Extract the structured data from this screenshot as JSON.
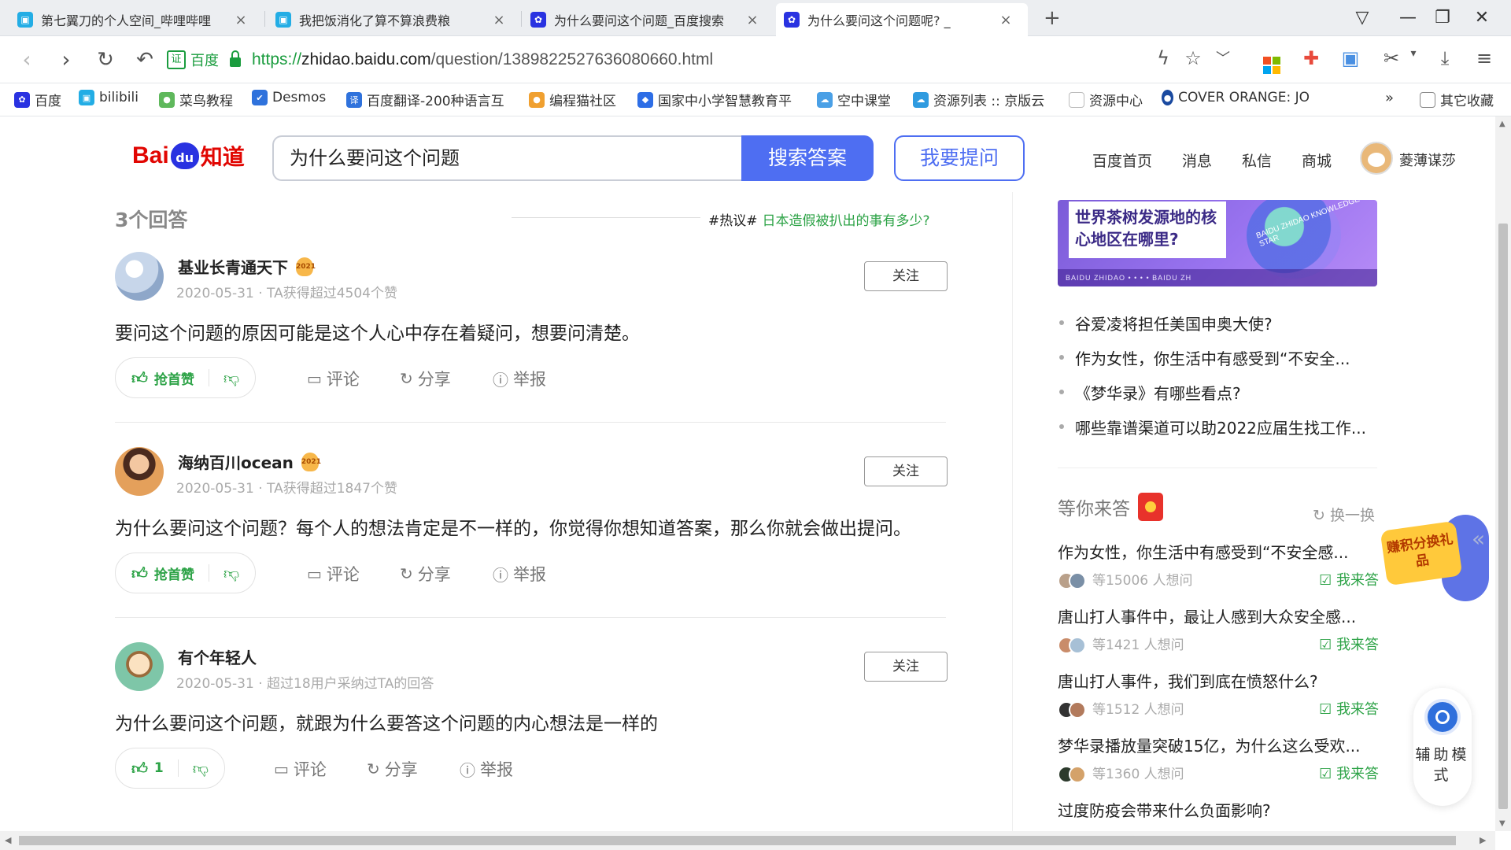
{
  "browser": {
    "tabs": [
      {
        "label": "第七翼刀的个人空间_哔哩哔哩",
        "icon": "bilibili-icon"
      },
      {
        "label": "我把饭消化了算不算浪费粮",
        "icon": "bilibili-icon"
      },
      {
        "label": "为什么要问这个问题_百度搜索",
        "icon": "baidu-icon"
      },
      {
        "label": "为什么要问这个问题呢? _",
        "icon": "baidu-icon",
        "active": true
      }
    ],
    "address": {
      "cert_label": "百度",
      "cert_icon": "证",
      "url_protocol": "https://",
      "url_host": "zhidao.baidu.com",
      "url_path": "/question/1389822527636080660.html"
    },
    "bookmarks": [
      {
        "label": "百度",
        "color": "#2932e1"
      },
      {
        "label": "bilibili",
        "color": "#23ade5"
      },
      {
        "label": "菜鸟教程",
        "color": "#5fb85c"
      },
      {
        "label": "Desmos",
        "color": "#2f72dc"
      },
      {
        "label": "百度翻译-200种语言互",
        "color": "#2f72dc"
      },
      {
        "label": "编程猫社区",
        "color": "#f0a030"
      },
      {
        "label": "国家中小学智慧教育平",
        "color": "#2e6ee6"
      },
      {
        "label": "空中课堂",
        "color": "#4aa0e6"
      },
      {
        "label": "资源列表 :: 京版云",
        "color": "#2f9be0"
      },
      {
        "label": "资源中心",
        "color": "#bbbbbb"
      },
      {
        "label": "COVER ORANGE: JO",
        "color": "#1a4aa0"
      }
    ],
    "bookmarks_more": "»",
    "other_bookmarks": "其它收藏"
  },
  "header": {
    "logo_bai": "Bai",
    "logo_du": "du",
    "logo_zhidao": "知道",
    "search_value": "为什么要问这个问题",
    "search_button": "搜索答案",
    "ask_button": "我要提问",
    "links": [
      "百度首页",
      "消息",
      "私信",
      "商城"
    ],
    "username": "菱薄谋莎"
  },
  "answers": {
    "count_label": "3个回答",
    "hot_tag": "#热议#",
    "hot_link": "日本造假被扒出的事有多少?",
    "follow_label": "关注",
    "comment_label": "评论",
    "share_label": "分享",
    "report_label": "举报",
    "items": [
      {
        "name": "基业长青通天下",
        "badge": "2021",
        "meta": "2020-05-31 · TA获得超过4504个赞",
        "content": "要问这个问题的原因可能是这个人心中存在着疑问，想要问清楚。",
        "vote_label": "抢首赞"
      },
      {
        "name": "海纳百川ocean",
        "badge": "2021",
        "meta": "2020-05-31 · TA获得超过1847个赞",
        "content": "为什么要问这个问题？每个人的想法肯定是不一样的，你觉得你想知道答案，那么你就会做出提问。",
        "vote_label": "抢首赞"
      },
      {
        "name": "有个年轻人",
        "badge": "",
        "meta": "2020-05-31 · 超过18用户采纳过TA的回答",
        "content": "为什么要问这个问题，就跟为什么要答这个问题的内心想法是一样的",
        "vote_label": "1"
      }
    ]
  },
  "sidebar": {
    "banner_text": "世界茶树发源地的核心地区在哪里?",
    "banner_footer": "BAIDU ZHIDAO • • • •   BAIDU ZH",
    "banner_badge": "BAIDU ZHIDAO KNOWLEDGE STAR",
    "hot_questions": [
      "谷爱凌将担任美国申奥大使?",
      "作为女性，你生活中有感受到“不安全...",
      "《梦华录》有哪些看点?",
      "哪些靠谱渠道可以助2022应届生找工作..."
    ],
    "wait_title": "等你来答",
    "refresh_label": "换一换",
    "answer_label": "我来答",
    "wait_questions": [
      {
        "title": "作为女性，你生活中有感受到“不安全感...",
        "want": "等15006 人想问"
      },
      {
        "title": "唐山打人事件中，最让人感到大众安全感...",
        "want": "等1421 人想问"
      },
      {
        "title": "唐山打人事件，我们到底在愤怒什么?",
        "want": "等1512 人想问"
      },
      {
        "title": "梦华录播放量突破15亿，为什么这么受欢...",
        "want": "等1360 人想问"
      }
    ],
    "last_question": "过度防疫会带来什么负面影响?"
  },
  "floats": {
    "promo_text": "赚积分换礼品",
    "assist_text": "辅助模式",
    "collapse": "«"
  },
  "colors": {
    "brand_blue": "#4e6ef2",
    "brand_red": "#e10602",
    "green": "#2ba245"
  }
}
